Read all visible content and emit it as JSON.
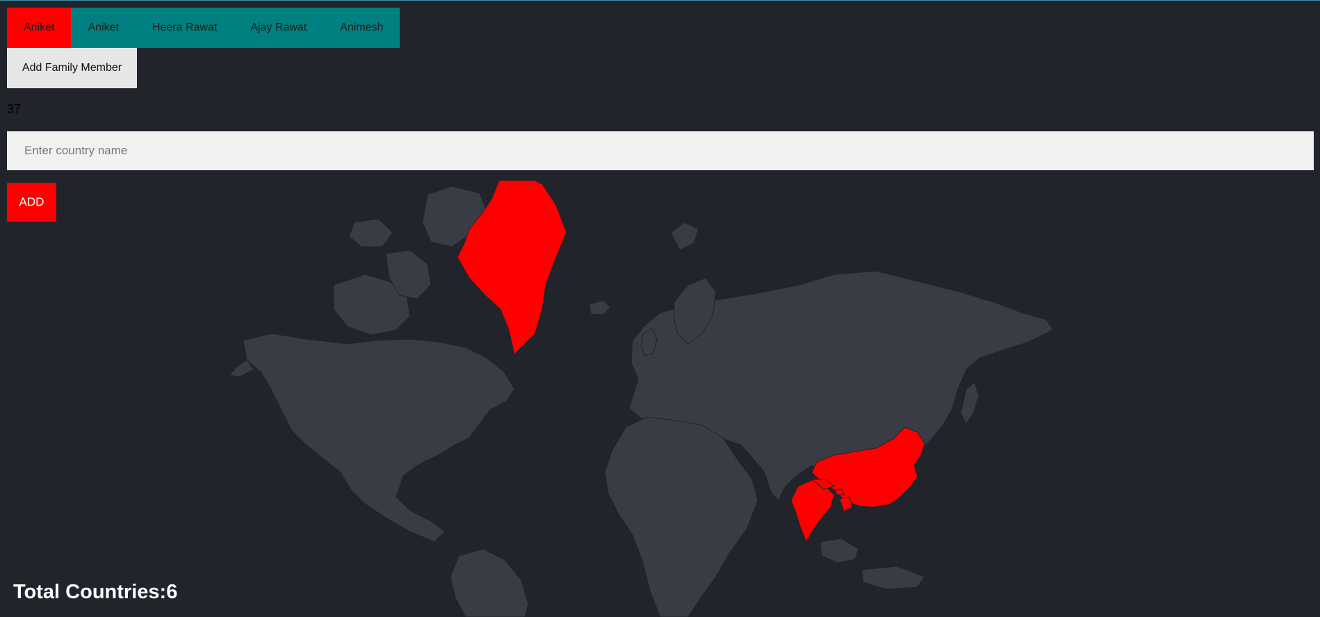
{
  "tabs": [
    {
      "label": "Aniket",
      "active": true
    },
    {
      "label": "Aniket",
      "active": false
    },
    {
      "label": "Heera Rawat",
      "active": false
    },
    {
      "label": "Ajay Rawat",
      "active": false
    },
    {
      "label": "Animesh",
      "active": false
    }
  ],
  "add_member_label": "Add Family Member",
  "count": "37",
  "search": {
    "placeholder": "Enter country name",
    "value": ""
  },
  "add_label": "ADD",
  "map": {
    "land_color": "#393c45",
    "border_color": "#22242b",
    "highlight_color": "#ff0000",
    "highlighted": [
      "Greenland",
      "China",
      "India",
      "Nepal",
      "Bhutan",
      "Bangladesh"
    ]
  },
  "total": {
    "label": "Total Countries:",
    "value": "6"
  }
}
